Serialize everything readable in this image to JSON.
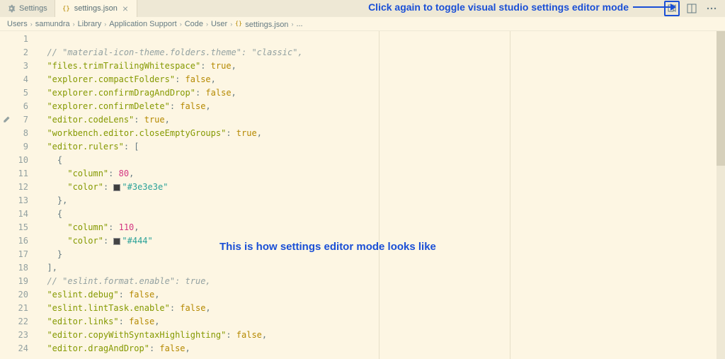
{
  "tabs": {
    "settings": "Settings",
    "json": "settings.json"
  },
  "breadcrumbs": [
    "Users",
    "samundra",
    "Library",
    "Application Support",
    "Code",
    "User",
    "settings.json",
    "..."
  ],
  "annotations": {
    "top": "Click again to toggle visual studio settings editor mode",
    "mid": "This is how settings editor mode looks like"
  },
  "code": [
    {
      "n": 1,
      "tokens": []
    },
    {
      "n": 2,
      "tokens": [
        [
          "ind",
          2
        ],
        [
          "comment",
          "// \"material-icon-theme.folders.theme\": \"classic\","
        ]
      ]
    },
    {
      "n": 3,
      "tokens": [
        [
          "ind",
          2
        ],
        [
          "key",
          "\"files.trimTrailingWhitespace\""
        ],
        [
          "punc",
          ": "
        ],
        [
          "bool",
          "true"
        ],
        [
          "punc",
          ","
        ]
      ]
    },
    {
      "n": 4,
      "tokens": [
        [
          "ind",
          2
        ],
        [
          "key",
          "\"explorer.compactFolders\""
        ],
        [
          "punc",
          ": "
        ],
        [
          "bool",
          "false"
        ],
        [
          "punc",
          ","
        ]
      ]
    },
    {
      "n": 5,
      "tokens": [
        [
          "ind",
          2
        ],
        [
          "key",
          "\"explorer.confirmDragAndDrop\""
        ],
        [
          "punc",
          ": "
        ],
        [
          "bool",
          "false"
        ],
        [
          "punc",
          ","
        ]
      ]
    },
    {
      "n": 6,
      "tokens": [
        [
          "ind",
          2
        ],
        [
          "key",
          "\"explorer.confirmDelete\""
        ],
        [
          "punc",
          ": "
        ],
        [
          "bool",
          "false"
        ],
        [
          "punc",
          ","
        ]
      ]
    },
    {
      "n": 7,
      "tokens": [
        [
          "ind",
          2
        ],
        [
          "key",
          "\"editor.codeLens\""
        ],
        [
          "punc",
          ": "
        ],
        [
          "bool",
          "true"
        ],
        [
          "punc",
          ","
        ]
      ],
      "modified": true
    },
    {
      "n": 8,
      "tokens": [
        [
          "ind",
          2
        ],
        [
          "key",
          "\"workbench.editor.closeEmptyGroups\""
        ],
        [
          "punc",
          ": "
        ],
        [
          "bool",
          "true"
        ],
        [
          "punc",
          ","
        ]
      ]
    },
    {
      "n": 9,
      "tokens": [
        [
          "ind",
          2
        ],
        [
          "key",
          "\"editor.rulers\""
        ],
        [
          "punc",
          ": "
        ],
        [
          "bracket",
          "["
        ]
      ]
    },
    {
      "n": 10,
      "tokens": [
        [
          "ind",
          4
        ],
        [
          "bracket",
          "{"
        ]
      ]
    },
    {
      "n": 11,
      "tokens": [
        [
          "ind",
          6
        ],
        [
          "key",
          "\"column\""
        ],
        [
          "punc",
          ": "
        ],
        [
          "num",
          "80"
        ],
        [
          "punc",
          ","
        ]
      ]
    },
    {
      "n": 12,
      "tokens": [
        [
          "ind",
          6
        ],
        [
          "key",
          "\"color\""
        ],
        [
          "punc",
          ": "
        ],
        [
          "swatch",
          "#3e3e3e"
        ],
        [
          "str",
          "\"#3e3e3e\""
        ]
      ]
    },
    {
      "n": 13,
      "tokens": [
        [
          "ind",
          4
        ],
        [
          "bracket",
          "}"
        ],
        [
          "punc",
          ","
        ]
      ]
    },
    {
      "n": 14,
      "tokens": [
        [
          "ind",
          4
        ],
        [
          "bracket",
          "{"
        ]
      ]
    },
    {
      "n": 15,
      "tokens": [
        [
          "ind",
          6
        ],
        [
          "key",
          "\"column\""
        ],
        [
          "punc",
          ": "
        ],
        [
          "num",
          "110"
        ],
        [
          "punc",
          ","
        ]
      ]
    },
    {
      "n": 16,
      "tokens": [
        [
          "ind",
          6
        ],
        [
          "key",
          "\"color\""
        ],
        [
          "punc",
          ": "
        ],
        [
          "swatch",
          "#444444"
        ],
        [
          "str",
          "\"#444\""
        ]
      ]
    },
    {
      "n": 17,
      "tokens": [
        [
          "ind",
          4
        ],
        [
          "bracket",
          "}"
        ]
      ]
    },
    {
      "n": 18,
      "tokens": [
        [
          "ind",
          2
        ],
        [
          "bracket",
          "]"
        ],
        [
          "punc",
          ","
        ]
      ]
    },
    {
      "n": 19,
      "tokens": [
        [
          "ind",
          2
        ],
        [
          "comment",
          "// \"eslint.format.enable\": true,"
        ]
      ]
    },
    {
      "n": 20,
      "tokens": [
        [
          "ind",
          2
        ],
        [
          "key",
          "\"eslint.debug\""
        ],
        [
          "punc",
          ": "
        ],
        [
          "bool",
          "false"
        ],
        [
          "punc",
          ","
        ]
      ]
    },
    {
      "n": 21,
      "tokens": [
        [
          "ind",
          2
        ],
        [
          "key",
          "\"eslint.lintTask.enable\""
        ],
        [
          "punc",
          ": "
        ],
        [
          "bool",
          "false"
        ],
        [
          "punc",
          ","
        ]
      ]
    },
    {
      "n": 22,
      "tokens": [
        [
          "ind",
          2
        ],
        [
          "key",
          "\"editor.links\""
        ],
        [
          "punc",
          ": "
        ],
        [
          "bool",
          "false"
        ],
        [
          "punc",
          ","
        ]
      ]
    },
    {
      "n": 23,
      "tokens": [
        [
          "ind",
          2
        ],
        [
          "key",
          "\"editor.copyWithSyntaxHighlighting\""
        ],
        [
          "punc",
          ": "
        ],
        [
          "bool",
          "false"
        ],
        [
          "punc",
          ","
        ]
      ]
    },
    {
      "n": 24,
      "tokens": [
        [
          "ind",
          2
        ],
        [
          "key",
          "\"editor.dragAndDrop\""
        ],
        [
          "punc",
          ": "
        ],
        [
          "bool",
          "false"
        ],
        [
          "punc",
          ","
        ]
      ]
    }
  ]
}
